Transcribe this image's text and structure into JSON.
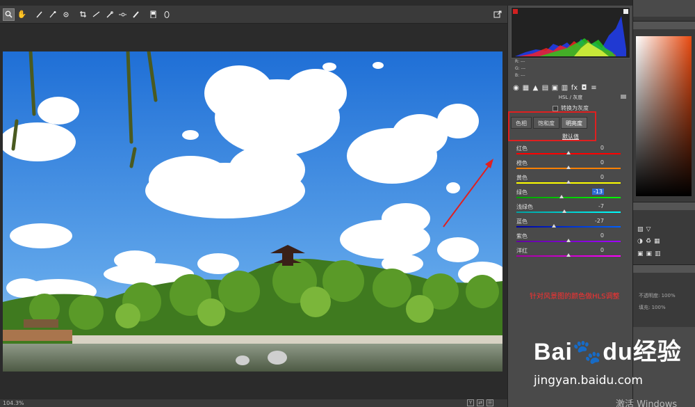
{
  "toolbar": {
    "tools": [
      "zoom-icon",
      "hand-icon",
      "white-balance-icon",
      "color-sampler-icon",
      "target-adjust-icon",
      "crop-icon",
      "straighten-icon",
      "spot-removal-icon",
      "redeye-icon",
      "adjust-brush-icon",
      "graduated-filter-icon",
      "radial-filter-icon"
    ]
  },
  "status": {
    "zoom": "104.3%"
  },
  "histogram": {
    "r_label": "R:",
    "g_label": "G:",
    "b_label": "B:",
    "r": "---",
    "g": "---",
    "b": "---"
  },
  "panel": {
    "section_title": "HSL / 灰度",
    "convert_gray": "转换为灰度",
    "tabs": [
      "色相",
      "饱和度",
      "明亮度"
    ],
    "active_tab": 2,
    "defaults": "默认值",
    "sliders": [
      {
        "label": "红色",
        "value": "0",
        "pos": 0.5,
        "colors": [
          "#ff0000",
          "#ff0000"
        ]
      },
      {
        "label": "橙色",
        "value": "0",
        "pos": 0.5,
        "colors": [
          "#ff8000",
          "#ff8000"
        ]
      },
      {
        "label": "黄色",
        "value": "0",
        "pos": 0.5,
        "colors": [
          "#ffff00",
          "#ffff00"
        ]
      },
      {
        "label": "绿色",
        "value": "-13",
        "pos": 0.43,
        "colors": [
          "#00a000",
          "#00ff00"
        ],
        "selected": true
      },
      {
        "label": "浅绿色",
        "value": "-7",
        "pos": 0.46,
        "colors": [
          "#00a0a0",
          "#00ffff"
        ]
      },
      {
        "label": "蓝色",
        "value": "-27",
        "pos": 0.36,
        "colors": [
          "#0000a0",
          "#0060ff"
        ]
      },
      {
        "label": "紫色",
        "value": "0",
        "pos": 0.5,
        "colors": [
          "#6000a0",
          "#a000ff"
        ]
      },
      {
        "label": "洋红",
        "value": "0",
        "pos": 0.5,
        "colors": [
          "#a000a0",
          "#ff00ff"
        ]
      }
    ]
  },
  "annotation": "针对风景图的颜色做HLS调整",
  "ps_side": {
    "opacity_label": "不透明度:",
    "opacity": "100%",
    "fill_label": "填充:",
    "fill": "100%"
  },
  "windows_text": "激活 Windows",
  "watermark": {
    "logo_a": "Bai",
    "logo_b": "du",
    "logo_c": "经验",
    "url": "jingyan.baidu.com"
  },
  "colors": {
    "annotation": "#ff3030",
    "frame": "#e02020"
  }
}
